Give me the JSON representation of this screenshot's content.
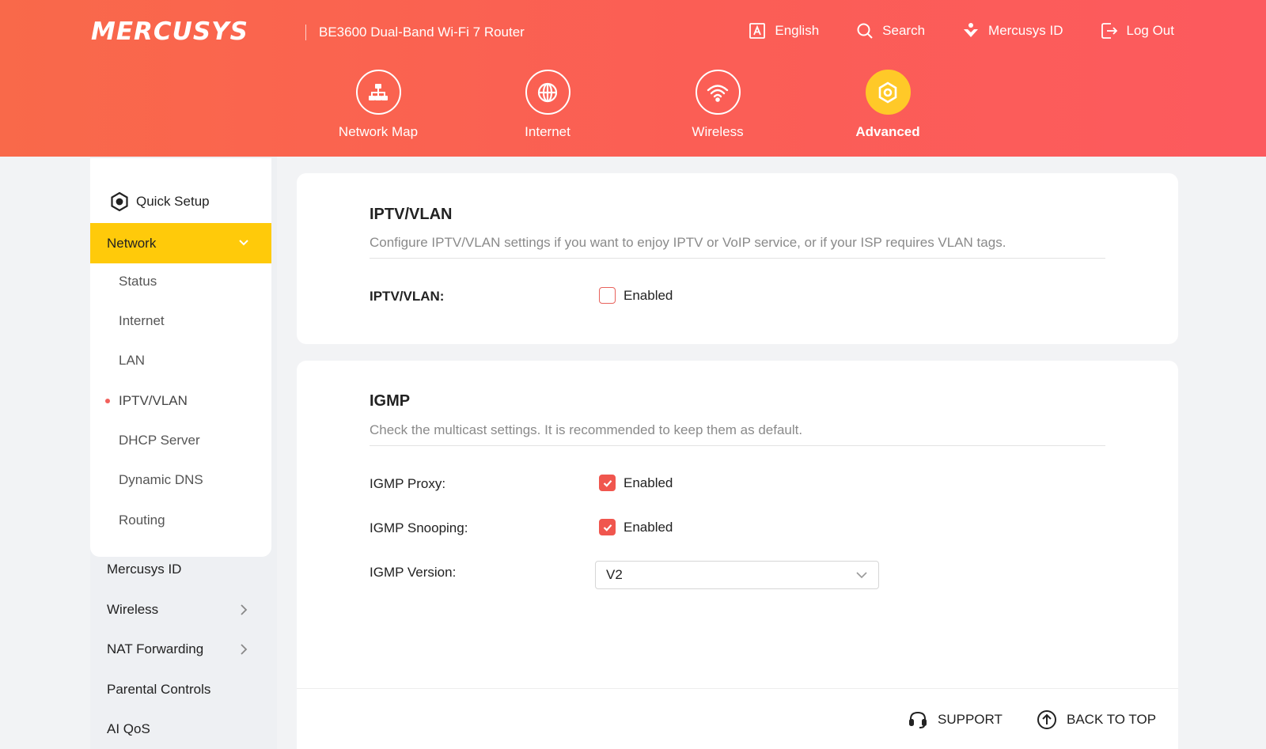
{
  "header": {
    "logo": "MERCUSYS",
    "product": "BE3600 Dual-Band Wi-Fi 7 Router",
    "links": [
      {
        "label": "English",
        "icon": "language-icon"
      },
      {
        "label": "Search",
        "icon": "search-icon"
      },
      {
        "label": "Mercusys ID",
        "icon": "mercusys-id-icon"
      },
      {
        "label": "Log Out",
        "icon": "logout-icon"
      }
    ]
  },
  "nav": [
    {
      "label": "Network Map",
      "icon": "network-map-icon"
    },
    {
      "label": "Internet",
      "icon": "globe-icon"
    },
    {
      "label": "Wireless",
      "icon": "wifi-icon"
    },
    {
      "label": "Advanced",
      "icon": "gear-icon",
      "active": true
    }
  ],
  "sidebar": {
    "quick_setup": "Quick Setup",
    "network": "Network",
    "network_sub": [
      "Status",
      "Internet",
      "LAN",
      "IPTV/VLAN",
      "DHCP Server",
      "Dynamic DNS",
      "Routing"
    ],
    "active_sub": "IPTV/VLAN",
    "main_items": [
      "Mercusys ID",
      "Wireless",
      "NAT Forwarding",
      "Parental Controls",
      "AI QoS"
    ]
  },
  "iptv": {
    "title": "IPTV/VLAN",
    "desc": "Configure IPTV/VLAN settings if you want to enjoy IPTV or VoIP service, or if your ISP requires VLAN tags.",
    "label": "IPTV/VLAN:",
    "option": "Enabled",
    "checked": false
  },
  "igmp": {
    "title": "IGMP",
    "desc": "Check the multicast settings. It is recommended to keep them as default.",
    "proxy_label": "IGMP Proxy:",
    "proxy_option": "Enabled",
    "proxy_checked": true,
    "snooping_label": "IGMP Snooping:",
    "snooping_option": "Enabled",
    "snooping_checked": true,
    "version_label": "IGMP Version:",
    "version_value": "V2"
  },
  "footer": {
    "support": "SUPPORT",
    "back_to_top": "BACK TO TOP"
  },
  "colors": {
    "header_start": "#f9694a",
    "header_end": "#fc5a5e",
    "accent_yellow": "#ffca0a",
    "checkbox_red": "#f0564e"
  }
}
